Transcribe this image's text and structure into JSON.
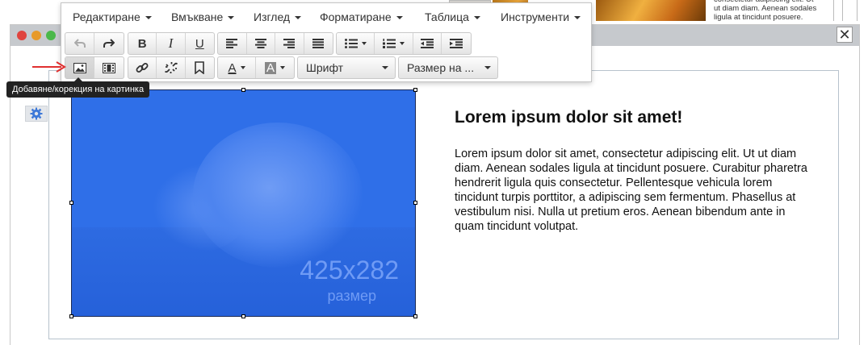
{
  "background": {
    "snippet_text": "consectetur adipiscing elit. Ut ut diam diam. Aenean sodales ligula at tincidunt posuere."
  },
  "window": {
    "close_label": "✕"
  },
  "menu": {
    "items": [
      {
        "label": "Редактиране"
      },
      {
        "label": "Вмъкване"
      },
      {
        "label": "Изглед"
      },
      {
        "label": "Форматиране"
      },
      {
        "label": "Таблица"
      },
      {
        "label": "Инструменти"
      }
    ]
  },
  "toolbar": {
    "bold": "B",
    "italic": "I",
    "underline": "U",
    "font_select": "Шрифт",
    "size_select": "Размер на ...",
    "font_color_letter": "A",
    "bg_color_letter": "A",
    "text_color": "#333333",
    "bg_color": "#888888"
  },
  "tooltip": {
    "text": "Добавяне/корекция на картинка"
  },
  "content": {
    "image_size_text": "425x282",
    "image_caption": "размер",
    "title": "Lorem ipsum dolor sit amet!",
    "body": "Lorem ipsum dolor sit amet, consectetur adipiscing elit. Ut ut diam diam. Aenean sodales ligula at tincidunt posuere. Curabitur pharetra hendrerit ligula quis consectetur. Pellentesque vehicula lorem tincidunt turpis porttitor, a adipiscing sem fermentum. Phasellus at vestibulum nisi. Nulla ut pretium eros. Aenean bibendum ante in quam tincidunt volutpat."
  },
  "colors": {
    "image_overlay": "#2f6fe8",
    "arrow": "#e03030",
    "titlebar": "#c6c9cd"
  }
}
